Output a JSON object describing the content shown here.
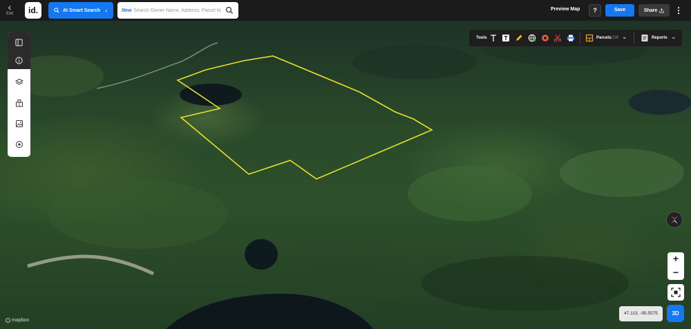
{
  "header": {
    "exit_label": "Exit",
    "logo_text": "id.",
    "ai_search_label": "AI Smart Search",
    "search_new_tag": "New",
    "search_placeholder": "Search Owner Name, Address, Parcel Id",
    "preview_label": "Preview Map",
    "help_label": "?",
    "save_label": "Save",
    "share_label": "Share"
  },
  "left_toolbar": {
    "items": [
      "panel-toggle-icon",
      "info-icon",
      "layers-icon",
      "buildings-icon",
      "image-icon",
      "location-pin-icon"
    ]
  },
  "tools_bar": {
    "tools_label": "Tools",
    "parcels_label": "Parcels:",
    "parcels_state": "Off",
    "reports_label": "Reports"
  },
  "map": {
    "coordinates": "47.113, -95.5575",
    "mode_3d_label": "3D",
    "zoom_in_label": "+",
    "zoom_out_label": "−",
    "attribution": "mapbox",
    "boundary_color": "#e6e22a"
  },
  "colors": {
    "accent": "#1677f2",
    "topbar": "#1b1b1b"
  }
}
